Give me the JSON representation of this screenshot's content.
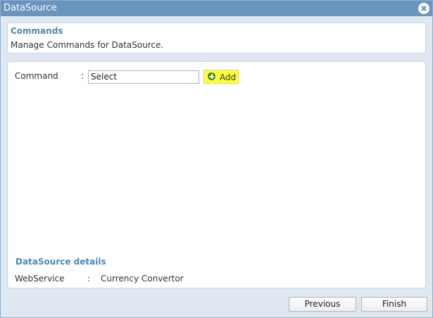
{
  "window": {
    "title": "DataSource"
  },
  "icons": {
    "close": "close-icon",
    "add": "plus-circle-icon"
  },
  "header": {
    "title": "Commands",
    "description": "Manage Commands for DataSource."
  },
  "command": {
    "label": "Command",
    "separator": ":",
    "selected": "Select",
    "add_label": "Add"
  },
  "details": {
    "title": "DataSource details",
    "label": "WebService",
    "separator": ":",
    "value": "Currency Convertor"
  },
  "footer": {
    "previous_label": "Previous",
    "finish_label": "Finish"
  },
  "colors": {
    "titlebar": "#6a93bd",
    "section_title": "#4a88b8",
    "add_highlight": "#ffff3a"
  }
}
